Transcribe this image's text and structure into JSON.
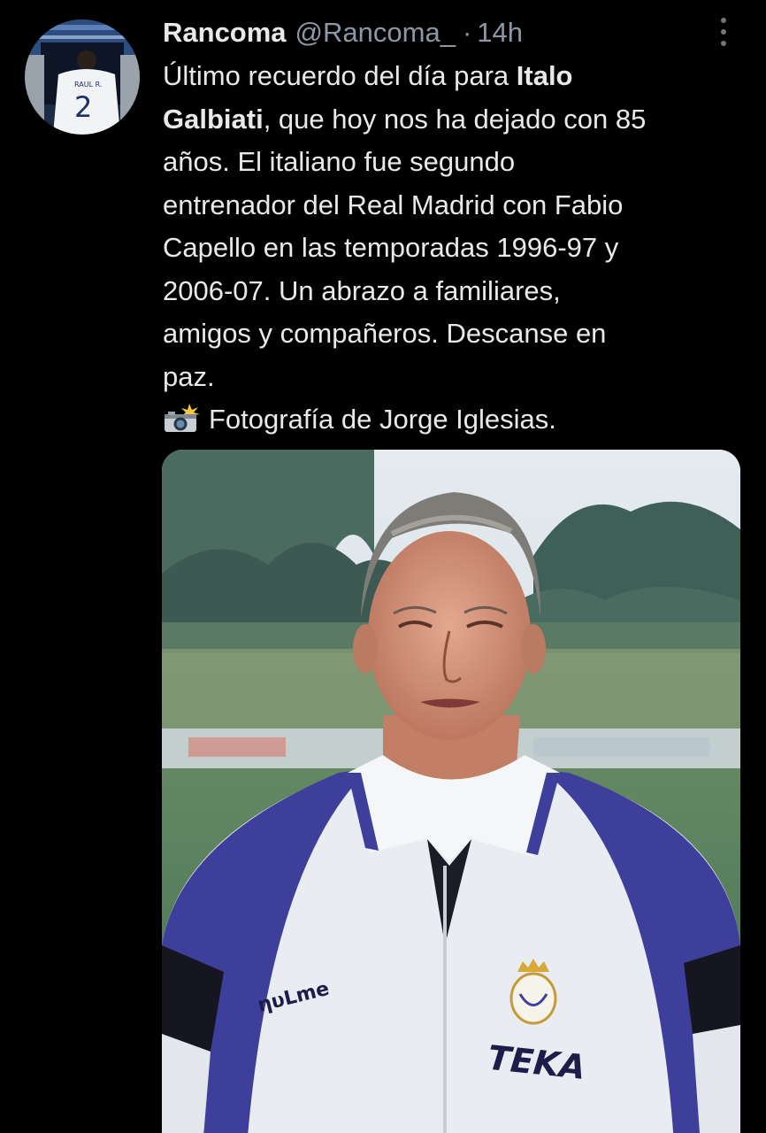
{
  "tweet": {
    "author": {
      "display_name": "Rancoma",
      "handle": "@Rancoma_",
      "avatar_icon": "profile-photo-jersey-icon",
      "avatar_jersey_name": "RAUL R.",
      "avatar_jersey_number": "2"
    },
    "separator": "·",
    "time": "14h",
    "more_icon": "more-vertical-icon",
    "text": {
      "line1_prefix": "Último recuerdo del día para ",
      "line1_bold": "Italo",
      "line2_bold": "Galbiati",
      "line2_suffix": ", que hoy nos ha dejado con 85",
      "line3": "años. El italiano fue segundo",
      "line4": "entrenador del Real Madrid con Fabio",
      "line5": "Capello en las temporadas 1996-97 y",
      "line6": "2006-07. Un abrazo a familiares,",
      "line7": "amigos y compañeros. Descanse en",
      "line8": "paz.",
      "credit": "Fotografía de Jorge Iglesias."
    },
    "credit_icon": "camera-flash-icon",
    "media": {
      "icon": "photo-of-man-in-football-polo",
      "shirt_brand": "ηυLme",
      "shirt_sponsor": "TEKA",
      "colors": {
        "sky": "#dbe4ea",
        "trees": "#3c5a52",
        "grass": "#4f7f5a",
        "shirt_white": "#e9edf2",
        "shirt_blue": "#3e3f9a"
      }
    }
  }
}
